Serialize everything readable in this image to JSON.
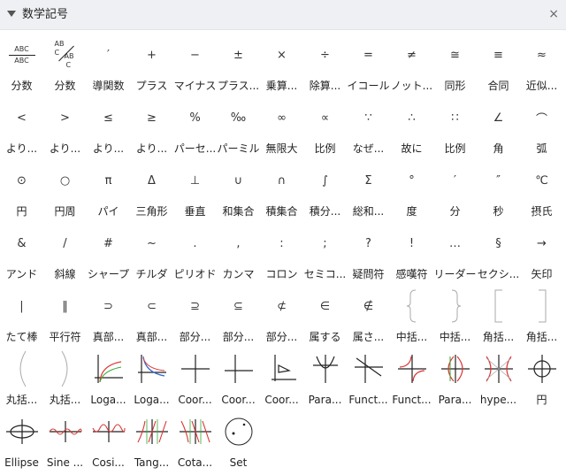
{
  "panel": {
    "title": "数学記号",
    "close_glyph": "×"
  },
  "rows": [
    [
      {
        "label": "分数",
        "kind": "frac1",
        "glyph": "",
        "texts": [
          "ABC",
          "ABC"
        ]
      },
      {
        "label": "分数",
        "kind": "frac2",
        "glyph": "",
        "texts": [
          "AB",
          "C",
          "AB",
          "C"
        ]
      },
      {
        "label": "導関数",
        "kind": "glyph",
        "glyph": "′"
      },
      {
        "label": "プラス",
        "kind": "glyph",
        "glyph": "+"
      },
      {
        "label": "マイナス",
        "kind": "glyph",
        "glyph": "−"
      },
      {
        "label": "プラス...",
        "kind": "glyph",
        "glyph": "±"
      },
      {
        "label": "乗算...",
        "kind": "glyph",
        "glyph": "×"
      },
      {
        "label": "除算...",
        "kind": "glyph",
        "glyph": "÷"
      },
      {
        "label": "イコール",
        "kind": "glyph",
        "glyph": "="
      },
      {
        "label": "ノット...",
        "kind": "glyph",
        "glyph": "≠"
      },
      {
        "label": "同形",
        "kind": "glyph",
        "glyph": "≅"
      },
      {
        "label": "合同",
        "kind": "glyph",
        "glyph": "≡"
      },
      {
        "label": "近似...",
        "kind": "glyph",
        "glyph": "≈"
      }
    ],
    [
      {
        "label": "より...",
        "kind": "glyph",
        "glyph": "<"
      },
      {
        "label": "より...",
        "kind": "glyph",
        "glyph": ">"
      },
      {
        "label": "より...",
        "kind": "glyph",
        "glyph": "≤"
      },
      {
        "label": "より...",
        "kind": "glyph",
        "glyph": "≥"
      },
      {
        "label": "パーセ...",
        "kind": "glyph",
        "glyph": "%"
      },
      {
        "label": "パーミル",
        "kind": "glyph",
        "glyph": "‰"
      },
      {
        "label": "無限大",
        "kind": "glyph",
        "glyph": "∞"
      },
      {
        "label": "比例",
        "kind": "glyph",
        "glyph": "∝"
      },
      {
        "label": "なぜ...",
        "kind": "glyph",
        "glyph": "∵"
      },
      {
        "label": "故に",
        "kind": "glyph",
        "glyph": "∴"
      },
      {
        "label": "比例",
        "kind": "glyph",
        "glyph": "∷"
      },
      {
        "label": "角",
        "kind": "glyph",
        "glyph": "∠"
      },
      {
        "label": "弧",
        "kind": "glyph",
        "glyph": "⌒"
      }
    ],
    [
      {
        "label": "円",
        "kind": "glyph",
        "glyph": "⊙"
      },
      {
        "label": "円周",
        "kind": "glyph",
        "glyph": "○"
      },
      {
        "label": "パイ",
        "kind": "glyph",
        "glyph": "π"
      },
      {
        "label": "三角形",
        "kind": "glyph",
        "glyph": "Δ"
      },
      {
        "label": "垂直",
        "kind": "glyph",
        "glyph": "⊥"
      },
      {
        "label": "和集合",
        "kind": "glyph",
        "glyph": "∪"
      },
      {
        "label": "積集合",
        "kind": "glyph",
        "glyph": "∩"
      },
      {
        "label": "積分...",
        "kind": "glyph",
        "glyph": "∫"
      },
      {
        "label": "総和...",
        "kind": "glyph",
        "glyph": "Σ"
      },
      {
        "label": "度",
        "kind": "glyph",
        "glyph": "°"
      },
      {
        "label": "分",
        "kind": "glyph",
        "glyph": "′"
      },
      {
        "label": "秒",
        "kind": "glyph",
        "glyph": "″"
      },
      {
        "label": "摂氏",
        "kind": "glyph",
        "glyph": "℃"
      }
    ],
    [
      {
        "label": "アンド",
        "kind": "glyph",
        "glyph": "&"
      },
      {
        "label": "斜線",
        "kind": "glyph",
        "glyph": "/"
      },
      {
        "label": "シャープ",
        "kind": "glyph",
        "glyph": "#"
      },
      {
        "label": "チルダ",
        "kind": "glyph",
        "glyph": "~"
      },
      {
        "label": "ピリオド",
        "kind": "glyph",
        "glyph": "."
      },
      {
        "label": "カンマ",
        "kind": "glyph",
        "glyph": ","
      },
      {
        "label": "コロン",
        "kind": "glyph",
        "glyph": ":"
      },
      {
        "label": "セミコ...",
        "kind": "glyph",
        "glyph": ";"
      },
      {
        "label": "疑問符",
        "kind": "glyph",
        "glyph": "?"
      },
      {
        "label": "感嘆符",
        "kind": "glyph",
        "glyph": "!"
      },
      {
        "label": "リーダー",
        "kind": "glyph",
        "glyph": "…"
      },
      {
        "label": "セクシ...",
        "kind": "glyph",
        "glyph": "§"
      },
      {
        "label": "矢印",
        "kind": "glyph",
        "glyph": "→"
      }
    ],
    [
      {
        "label": "たて棒",
        "kind": "glyph",
        "glyph": "|"
      },
      {
        "label": "平行符",
        "kind": "glyph",
        "glyph": "‖"
      },
      {
        "label": "真部...",
        "kind": "glyph",
        "glyph": "⊃"
      },
      {
        "label": "真部...",
        "kind": "glyph",
        "glyph": "⊂"
      },
      {
        "label": "部分...",
        "kind": "glyph",
        "glyph": "⊇"
      },
      {
        "label": "部分...",
        "kind": "glyph",
        "glyph": "⊆"
      },
      {
        "label": "部分...",
        "kind": "glyph",
        "glyph": "⊄"
      },
      {
        "label": "属する",
        "kind": "glyph",
        "glyph": "∈"
      },
      {
        "label": "属さ...",
        "kind": "glyph",
        "glyph": "∉"
      },
      {
        "label": "中括...",
        "kind": "brace-l",
        "glyph": ""
      },
      {
        "label": "中括...",
        "kind": "brace-r",
        "glyph": ""
      },
      {
        "label": "角括...",
        "kind": "bracket-l",
        "glyph": ""
      },
      {
        "label": "角括...",
        "kind": "bracket-r",
        "glyph": ""
      }
    ],
    [
      {
        "label": "丸括...",
        "kind": "paren-l",
        "glyph": ""
      },
      {
        "label": "丸括...",
        "kind": "paren-r",
        "glyph": ""
      },
      {
        "label": "Loga...",
        "kind": "log1",
        "glyph": ""
      },
      {
        "label": "Loga...",
        "kind": "log2",
        "glyph": ""
      },
      {
        "label": "Coor...",
        "kind": "coord1",
        "glyph": ""
      },
      {
        "label": "Coor...",
        "kind": "coord2",
        "glyph": ""
      },
      {
        "label": "Coor...",
        "kind": "coord3",
        "glyph": ""
      },
      {
        "label": "Para...",
        "kind": "para1",
        "glyph": ""
      },
      {
        "label": "Funct...",
        "kind": "func1",
        "glyph": ""
      },
      {
        "label": "Funct...",
        "kind": "func2",
        "glyph": ""
      },
      {
        "label": "Para...",
        "kind": "para2",
        "glyph": ""
      },
      {
        "label": "hype...",
        "kind": "hyper",
        "glyph": ""
      },
      {
        "label": "円",
        "kind": "circle",
        "glyph": ""
      }
    ],
    [
      {
        "label": "Ellipse",
        "kind": "ellipse",
        "glyph": ""
      },
      {
        "label": "Sine ...",
        "kind": "sine",
        "glyph": ""
      },
      {
        "label": "Cosi...",
        "kind": "cosine",
        "glyph": ""
      },
      {
        "label": "Tang...",
        "kind": "tangent",
        "glyph": ""
      },
      {
        "label": "Cota...",
        "kind": "cotangent",
        "glyph": ""
      },
      {
        "label": "Set",
        "kind": "set",
        "glyph": ""
      }
    ]
  ]
}
